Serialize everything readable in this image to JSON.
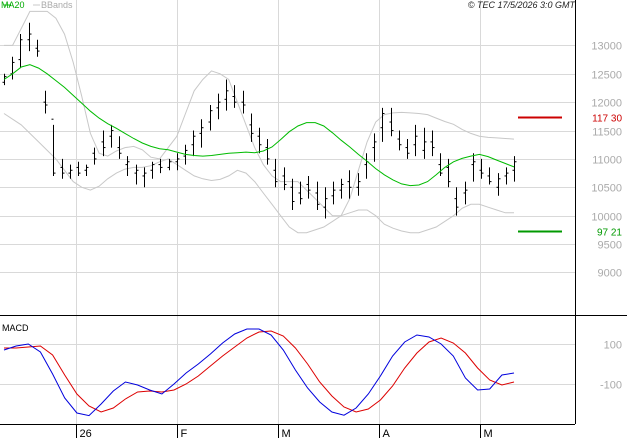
{
  "header": {
    "legend_ma": "MA20",
    "legend_bbands": "BBands",
    "copyright": "© TEC 17/5/2026 3:0 GMT"
  },
  "macd_panel": {
    "title": "MACD"
  },
  "colors": {
    "ma20": "#00bb00",
    "bbands": "#c8c8c8",
    "candle": "#000000",
    "resistance": "#cc0000",
    "support": "#009900",
    "macd": "#0000dd",
    "signal": "#dd0000",
    "grid": "#d9d9d9",
    "tick_label": "#aaaaaa"
  },
  "chart_data": [
    {
      "type": "candlestick",
      "title": "",
      "xlabel": "",
      "ylabel": "",
      "ylim": [
        8250,
        13800
      ],
      "grid": true,
      "x_tick_labels": [
        "26",
        "F",
        "M",
        "A",
        "M"
      ],
      "y_tick_values": [
        9000,
        9500,
        10000,
        10500,
        11000,
        11500,
        12000,
        12500,
        13000
      ],
      "y_tick_labels": [
        "9000",
        "9500",
        "10000",
        "10500",
        "11000",
        "11500",
        "12000",
        "12500",
        "13000"
      ],
      "annotations": [
        {
          "label": "117 30",
          "value": 11730,
          "color": "resistance"
        },
        {
          "label": "97 21",
          "value": 9721,
          "color": "support"
        }
      ],
      "series": [
        {
          "name": "MA20",
          "values": [
            12400,
            12500,
            12620,
            12660,
            12600,
            12500,
            12380,
            12260,
            12120,
            11980,
            11840,
            11720,
            11620,
            11540,
            11450,
            11360,
            11280,
            11220,
            11180,
            11160,
            11120,
            11080,
            11060,
            11050,
            11060,
            11080,
            11100,
            11110,
            11120,
            11110,
            11140,
            11210,
            11340,
            11480,
            11580,
            11640,
            11640,
            11580,
            11460,
            11330,
            11210,
            11080,
            10960,
            10830,
            10720,
            10630,
            10560,
            10530,
            10540,
            10600,
            10720,
            10850,
            10950,
            11010,
            11050,
            11080,
            11040,
            10980,
            10920,
            10860
          ]
        },
        {
          "name": "BBands",
          "values": [
            13000,
            13000,
            13300,
            13600,
            13600,
            13600,
            13480,
            13200,
            12700,
            12100,
            11450,
            11100,
            11050,
            11140,
            11200,
            11220,
            11160,
            11030,
            11000,
            11200,
            11400,
            11800,
            12200,
            12400,
            12550,
            12500,
            12400,
            12000,
            11600,
            11200,
            10900,
            10700,
            10600,
            10600,
            10600,
            10450,
            10300,
            10150,
            10000,
            10000,
            10300,
            10800,
            11300,
            11650,
            11780,
            11810,
            11820,
            11810,
            11800,
            11780,
            11720,
            11660,
            11610,
            11520,
            11450,
            11400,
            11380,
            11370,
            11360,
            11350
          ]
        },
        {
          "name": "BBands",
          "values": [
            11800,
            11700,
            11600,
            11450,
            11300,
            11150,
            11000,
            10800,
            10600,
            10500,
            10450,
            10520,
            10650,
            10750,
            10820,
            10850,
            10850,
            10880,
            10950,
            11000,
            10900,
            10800,
            10700,
            10650,
            10620,
            10640,
            10700,
            10800,
            10750,
            10600,
            10400,
            10200,
            10000,
            9800,
            9700,
            9700,
            9750,
            9800,
            9900,
            10000,
            10050,
            10100,
            10100,
            10000,
            9850,
            9780,
            9730,
            9700,
            9700,
            9750,
            9800,
            9900,
            10000,
            10130,
            10200,
            10200,
            10150,
            10100,
            10050,
            10050
          ]
        }
      ],
      "candles": [
        [
          12350,
          12500,
          12300,
          12450
        ],
        [
          12500,
          12800,
          12400,
          12700
        ],
        [
          12750,
          13200,
          12600,
          13100
        ],
        [
          13100,
          13400,
          12900,
          13200
        ],
        [
          12950,
          13100,
          12800,
          12900
        ],
        [
          12000,
          12200,
          11800,
          11950
        ],
        [
          11700,
          11600,
          10700,
          10750
        ],
        [
          10850,
          11000,
          10650,
          10750
        ],
        [
          10750,
          10900,
          10650,
          10800
        ],
        [
          10850,
          10950,
          10700,
          10750
        ],
        [
          10800,
          10900,
          10700,
          10850
        ],
        [
          11100,
          11200,
          10900,
          11000
        ],
        [
          11300,
          11500,
          11050,
          11200
        ],
        [
          11400,
          11600,
          11200,
          11500
        ],
        [
          11200,
          11400,
          11000,
          11100
        ],
        [
          10900,
          11050,
          10700,
          10950
        ],
        [
          10750,
          10900,
          10550,
          10800
        ],
        [
          10700,
          10850,
          10500,
          10750
        ],
        [
          10800,
          10950,
          10650,
          10900
        ],
        [
          10900,
          11000,
          10750,
          10850
        ],
        [
          10850,
          11000,
          10800,
          10950
        ],
        [
          10950,
          11100,
          10800,
          11000
        ],
        [
          11050,
          11250,
          10900,
          11150
        ],
        [
          11250,
          11500,
          11050,
          11400
        ],
        [
          11450,
          11700,
          11200,
          11550
        ],
        [
          11650,
          11950,
          11500,
          11850
        ],
        [
          11900,
          12150,
          11700,
          12000
        ],
        [
          12050,
          12400,
          11850,
          12200
        ],
        [
          12100,
          12300,
          11900,
          12000
        ],
        [
          12000,
          12200,
          11800,
          11950
        ],
        [
          11600,
          11800,
          11300,
          11450
        ],
        [
          11400,
          11550,
          11100,
          11250
        ],
        [
          11200,
          11350,
          10900,
          11000
        ],
        [
          10800,
          11000,
          10500,
          10600
        ],
        [
          10700,
          10850,
          10450,
          10550
        ],
        [
          10500,
          10650,
          10100,
          10250
        ],
        [
          10400,
          10600,
          10200,
          10300
        ],
        [
          10550,
          10700,
          10300,
          10450
        ],
        [
          10400,
          10600,
          10100,
          10200
        ],
        [
          10150,
          10500,
          9950,
          10300
        ],
        [
          10350,
          10600,
          10200,
          10450
        ],
        [
          10450,
          10650,
          10300,
          10550
        ],
        [
          10600,
          10800,
          10300,
          10500
        ],
        [
          10500,
          10750,
          10350,
          10600
        ],
        [
          10900,
          11100,
          10650,
          10950
        ],
        [
          11200,
          11450,
          10950,
          11300
        ],
        [
          11550,
          11900,
          11300,
          11800
        ],
        [
          11650,
          11900,
          11400,
          11500
        ],
        [
          11350,
          11500,
          11150,
          11250
        ],
        [
          11200,
          11350,
          11000,
          11100
        ],
        [
          11250,
          11600,
          11050,
          11400
        ],
        [
          11150,
          11550,
          11000,
          11300
        ],
        [
          11300,
          11500,
          11050,
          11200
        ],
        [
          10900,
          11100,
          10700,
          10750
        ],
        [
          10850,
          11000,
          10500,
          10600
        ],
        [
          10300,
          10500,
          10000,
          10150
        ],
        [
          10400,
          10600,
          10200,
          10450
        ],
        [
          10900,
          11100,
          10600,
          10950
        ],
        [
          10800,
          11000,
          10650,
          10750
        ],
        [
          10700,
          10850,
          10550,
          10600
        ],
        [
          10500,
          10750,
          10350,
          10650
        ],
        [
          10700,
          10850,
          10550,
          10750
        ],
        [
          10800,
          11050,
          10600,
          10950
        ]
      ]
    },
    {
      "type": "line",
      "title": "",
      "xlabel": "",
      "ylabel": "",
      "ylim": [
        -300,
        240
      ],
      "y_tick_values": [
        100,
        -100
      ],
      "y_tick_labels": [
        "100",
        "-100"
      ],
      "x_tick_labels": [
        "26",
        "F",
        "M",
        "A",
        "M"
      ],
      "series": [
        {
          "name": "MACD",
          "values": [
            70,
            90,
            100,
            60,
            -50,
            -170,
            -245,
            -258,
            -200,
            -135,
            -90,
            -105,
            -130,
            -150,
            -100,
            -45,
            0,
            50,
            105,
            150,
            175,
            175,
            145,
            70,
            -30,
            -120,
            -190,
            -240,
            -256,
            -220,
            -150,
            -60,
            40,
            110,
            145,
            135,
            100,
            40,
            -70,
            -130,
            -125,
            -55,
            -45
          ]
        },
        {
          "name": "Signal",
          "values": [
            80,
            80,
            85,
            90,
            45,
            -55,
            -150,
            -210,
            -240,
            -220,
            -175,
            -140,
            -135,
            -140,
            -130,
            -100,
            -60,
            -10,
            40,
            85,
            130,
            160,
            165,
            140,
            80,
            0,
            -90,
            -160,
            -215,
            -240,
            -225,
            -180,
            -110,
            -20,
            55,
            110,
            130,
            105,
            55,
            -20,
            -80,
            -105,
            -90
          ]
        }
      ]
    }
  ]
}
